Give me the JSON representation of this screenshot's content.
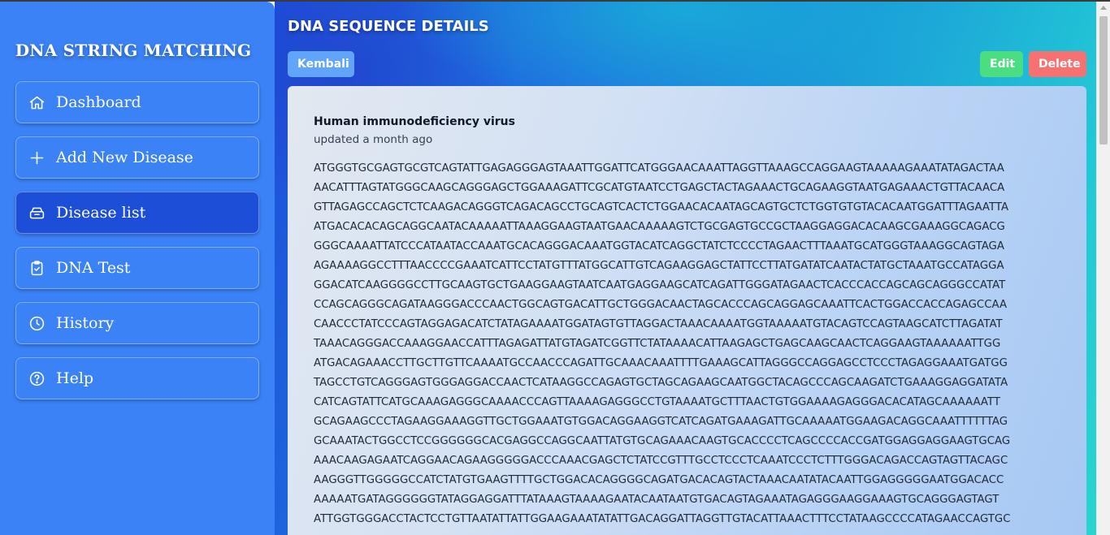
{
  "sidebar": {
    "brand": "DNA STRING MATCHING",
    "items": [
      {
        "label": "Dashboard",
        "icon": "home-icon"
      },
      {
        "label": "Add New Disease",
        "icon": "plus-icon"
      },
      {
        "label": "Disease list",
        "icon": "archive-icon"
      },
      {
        "label": "DNA Test",
        "icon": "clipboard-check-icon"
      },
      {
        "label": "History",
        "icon": "clock-icon"
      },
      {
        "label": "Help",
        "icon": "help-circle-icon"
      }
    ],
    "active_item": "Disease list"
  },
  "header": {
    "title": "DNA SEQUENCE DETAILS"
  },
  "actions": {
    "back_label": "Kembali",
    "edit_label": "Edit",
    "delete_label": "Delete"
  },
  "detail": {
    "name": "Human immunodeficiency virus",
    "updated": "updated a month ago",
    "sequence_lines": [
      "ATGGGTGCGAGTGCGTCAGTATTGAGAGGGAGTAAATTGGATTCATGGGAACAAATTAGGTTAAAGCCAGGAAGTAAAAAGAAATATAGACTAA",
      "AACATTTAGTATGGGCAAGCAGGGAGCTGGAAAGATTCGCATGTAATCCTGAGCTACTAGAAACTGCAGAAGGTAATGAGAAACTGTTACAACA",
      "GTTAGAGCCAGCTCTCAAGACAGGGTCAGACAGCCTGCAGTCACTCTGGAACACAATAGCAGTGCTCTGGTGTGTACACAATGGATTTAGAATTA",
      "ATGACACACAGCAGGCAATACAAAAATTAAAGGAAGTAATGAACAAAAAGTCTGCGAGTGCCGCTAAGGAGGACACAAGCGAAAGGCAGACG",
      "GGGCAAAATTATCCCATAATACCAAATGCACAGGGACAAATGGTACATCAGGCTATCTCCCCTAGAACTTTAAATGCATGGGTAAAGGCAGTAGA",
      "AGAAAAGGCCTTTAACCCCGAAATCATTCCTATGTTTATGGCATTGTCAGAAGGAGCTATTCCTTATGATATCAATACTATGCTAAATGCCATAGGA",
      "GGACATCAAGGGGCCTTGCAAGTGCTGAAGGAAGTAATCAATGAGGAAGCATCAGATTGGGATAGAACTCACCCACCAGCAGCAGGGCCATAT",
      "CCAGCAGGGCAGATAAGGGACCCAACTGGCAGTGACATTGCTGGGACAACTAGCACCCAGCAGGAGCAAATTCACTGGACCACCAGAGCCAA",
      "CAACCCTATCCCAGTAGGAGACATCTATAGAAAATGGATAGTGTTAGGACTAAACAAAATGGTAAAAATGTACAGTCCAGTAAGCATCTTAGATAT",
      "TAAACAGGGACCAAAGGAACCATTTAGAGATTATGTAGATCGGTTCTATAAAACATTAAGAGCTGAGCAAGCAACTCAGGAAGTAAAAAATTGG",
      "ATGACAGAAACCTTGCTTGTTCAAAATGCCAACCCAGATTGCAAACAAATTTTGAAAGCATTAGGGCCAGGAGCCTCCCTAGAGGAAATGATGG",
      "TAGCCTGTCAGGGAGTGGGAGGACCAACTCATAAGGCCAGAGTGCTAGCAGAAGCAATGGCTACAGCCCAGCAAGATCTGAAAGGAGGATATA",
      "CATCAGTATTCATGCAAAGAGGGCAAAACCCAGTTAAAAGAGGGCCTGTAAAATGCTTTAACTGTGGAAAAGAGGGACACATAGCAAAAAATT",
      "GCAGAAGCCCTAGAAGGAAAGGTTGCTGGAAATGTGGACAGGAAGGTCATCAGATGAAAGATTGCAAAAATGGAAGACAGGCAAATTTTTTAG",
      "GCAAATACTGGCCTCCGGGGGGCACGAGGCCAGGCAATTATGTGCAGAAACAAGTGCACCCCTCAGCCCCACCGATGGAGGAGGAAGTGCAG",
      "AAACAAGAGAATCAGGAACAGAAGGGGGACCCAAACGAGCTCTATCCGTTTGCCTCCCTCAAATCCCTCTTTGGGACAGACCAGTAGTTACAGC",
      "AAGGGTTGGGGGCCATCTATGTGAAGTTTTGCTGGACACAGGGGCAGATGACACAGTACTAAACAATATACAATTGGAGGGGGAATGGACACC",
      "AAAAATGATAGGGGGGTATAGGAGGATTTATAAAGTAAAAGAATACAATAATGTGACAGTAGAAATAGAGGGAAGGAAAGTGCAGGGAGTAGT",
      "ATTGGTGGGACCTACTCCTGTTAATATTATTGGAAGAAATATATTGACAGGATTAGGTTGTACATTAAACTTTCCTATAAGCCCCATAGAACCAGTGC"
    ]
  },
  "colors": {
    "sidebar_bg": "#3b82f6",
    "sidebar_active": "#1d4ed8",
    "back_button": "#60a5fa",
    "edit_button": "#4ade80",
    "delete_button": "#f87171"
  }
}
